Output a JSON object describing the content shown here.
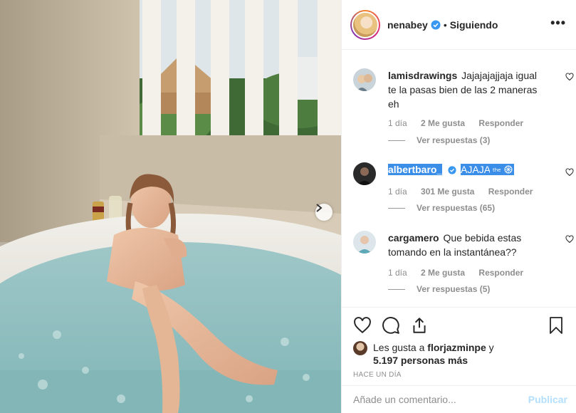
{
  "post": {
    "username": "nenabey",
    "separator": "•",
    "follow_status": "Siguiendo",
    "more_label": "•••"
  },
  "comments": [
    {
      "username": "lamisdrawings",
      "text": "Jajajajajjaja igual te la pasas bien de las 2 maneras eh",
      "time": "1 día",
      "likes": "2 Me gusta",
      "reply": "Responder",
      "replies": "Ver respuestas (3)"
    },
    {
      "username": "albertbaro_",
      "text": "AJAJA",
      "time": "1 día",
      "likes": "301 Me gusta",
      "reply": "Responder",
      "replies": "Ver respuestas (65)"
    },
    {
      "username": "cargamero",
      "text": "Que bebida estas tomando en la instantánea??",
      "time": "1 día",
      "likes": "2 Me gusta",
      "reply": "Responder",
      "replies": "Ver respuestas (5)"
    }
  ],
  "likes": {
    "prefix": "Les gusta a ",
    "user": "florjazminpe",
    "joiner": " y",
    "count": "5.197 personas más"
  },
  "timestamp": "HACE UN DÍA",
  "comment_box": {
    "placeholder": "Añade un comentario...",
    "publish": "Publicar"
  },
  "icons": {
    "verified": "verified-badge-icon",
    "like": "heart-icon",
    "comment": "comment-bubble-icon",
    "share": "share-icon",
    "save": "bookmark-icon",
    "next": "chevron-right-icon"
  },
  "colors": {
    "verified_blue": "#3897f0",
    "highlight": "#3b8ee8",
    "muted": "#8e8e8e",
    "publish_disabled": "#b2dffc"
  }
}
